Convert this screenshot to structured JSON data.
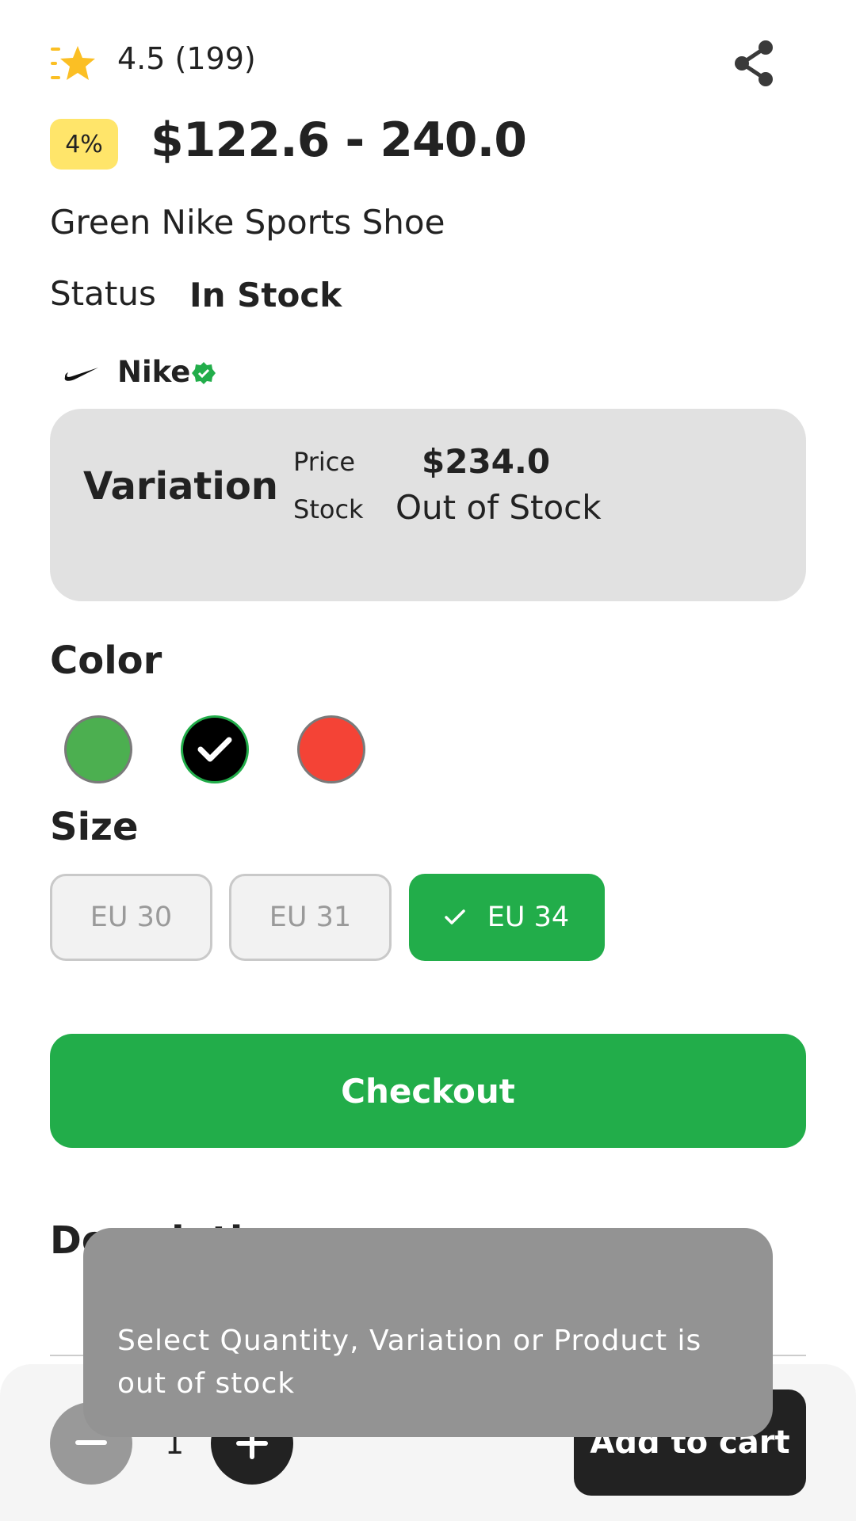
{
  "rating": {
    "value": "4.5",
    "count": "(199)",
    "text": "4.5 (199)"
  },
  "price": {
    "discount": "4%",
    "range": "$122.6 - 240.0"
  },
  "product": {
    "title": "Green Nike Sports Shoe"
  },
  "status": {
    "label": "Status",
    "value": "In Stock"
  },
  "brand": {
    "name": "Nike",
    "verified": true
  },
  "variation": {
    "title": "Variation",
    "price_label": "Price",
    "price_value": "$234.0",
    "stock_label": "Stock",
    "stock_value": "Out of Stock"
  },
  "color": {
    "heading": "Color",
    "options": [
      {
        "hex": "#4caf50",
        "selected": false
      },
      {
        "hex": "#000000",
        "selected": true
      },
      {
        "hex": "#f44336",
        "selected": false
      }
    ]
  },
  "size": {
    "heading": "Size",
    "options": [
      {
        "label": "EU 30",
        "selected": false
      },
      {
        "label": "EU 31",
        "selected": false
      },
      {
        "label": "EU 34",
        "selected": true
      }
    ]
  },
  "checkout": {
    "label": "Checkout"
  },
  "description": {
    "heading": "Description"
  },
  "quantity": {
    "value": "1"
  },
  "cart": {
    "label": "Add to cart"
  },
  "toast": {
    "message": "Select Quantity, Variation or Product is out of stock"
  },
  "colors": {
    "accent": "#22ad4a",
    "badge": "#ffe56a",
    "dark": "#222222",
    "star": "#fbbf24"
  },
  "icons": [
    "rating-star-icon",
    "share-icon",
    "nike-logo",
    "verified-badge-icon",
    "check-icon",
    "minus-icon",
    "plus-icon"
  ]
}
